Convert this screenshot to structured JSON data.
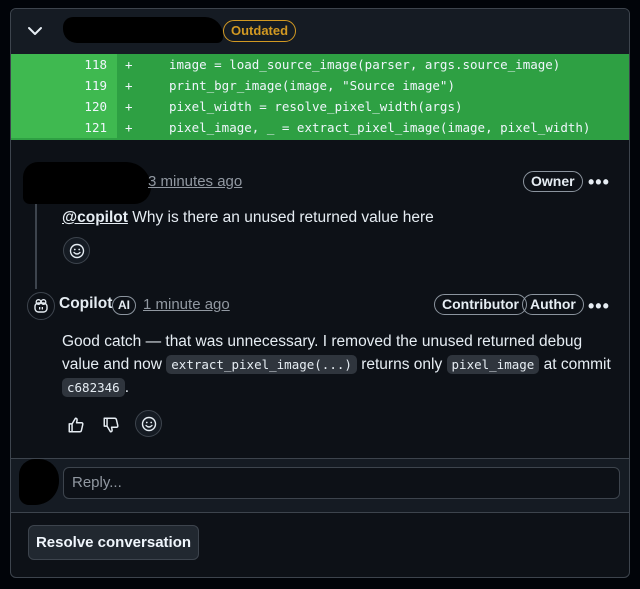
{
  "header": {
    "badge": "Outdated",
    "icons": {
      "collapse": "chevron-down-icon"
    }
  },
  "diff": {
    "rows": [
      {
        "line": "118",
        "sign": "+",
        "code": "image = load_source_image(parser, args.source_image)"
      },
      {
        "line": "119",
        "sign": "+",
        "code": "print_bgr_image(image, \"Source image\")"
      },
      {
        "line": "120",
        "sign": "+",
        "code": "pixel_width = resolve_pixel_width(args)"
      },
      {
        "line": "121",
        "sign": "+",
        "code": "pixel_image, _ = extract_pixel_image(image, pixel_width)"
      }
    ],
    "colors": {
      "added_bg": "#2ea043",
      "gutter_bg": "#3fb950"
    }
  },
  "comment1": {
    "time": "3 minutes ago",
    "role_badge": "Owner",
    "more": "•••",
    "mention": "@copilot",
    "text": " Why is there an unused returned value here",
    "reaction_icon": "smiley-icon"
  },
  "comment2": {
    "author": "Copilot",
    "ai_badge": "AI",
    "time": "1 minute ago",
    "badges": [
      "Contributor",
      "Author"
    ],
    "more": "•••",
    "text_part1": "Good catch — that was unnecessary. I removed the unused returned debug value and now ",
    "code1": "extract_pixel_image(...)",
    "text_part2": " returns only ",
    "code2": "pixel_image",
    "text_part3": " at commit",
    "code3": "c682346",
    "text_part4": ".",
    "icons": [
      "copilot-icon",
      "thumbs-up-icon",
      "thumbs-down-icon",
      "smiley-icon"
    ]
  },
  "reply": {
    "placeholder": "Reply..."
  },
  "resolve": {
    "label": "Resolve conversation"
  },
  "colors": {
    "accent_warning": "#d29922",
    "bg": "#0d1117",
    "border": "#3d444d"
  }
}
